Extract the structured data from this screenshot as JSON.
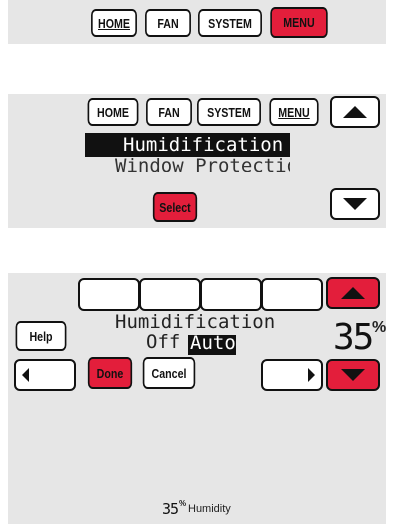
{
  "top_bar": {
    "home": "HOME",
    "fan": "FAN",
    "system": "SYSTEM",
    "menu": "MENU"
  },
  "menu_screen": {
    "tabs": {
      "home": "HOME",
      "fan": "FAN",
      "system": "SYSTEM",
      "menu": "MENU"
    },
    "selected_item": "Humidification",
    "next_item": "Window Protection",
    "select_label": "Select"
  },
  "humid_screen": {
    "help_label": "Help",
    "title": "Humidification",
    "option_off": "Off",
    "option_auto": "Auto",
    "setpoint_value": "35",
    "setpoint_unit": "%",
    "done_label": "Done",
    "cancel_label": "Cancel",
    "status_value": "35",
    "status_unit": "%",
    "status_label": "Humidity"
  },
  "colors": {
    "accent_red": "#e31e3b",
    "panel_gray": "#e6e6e6"
  }
}
